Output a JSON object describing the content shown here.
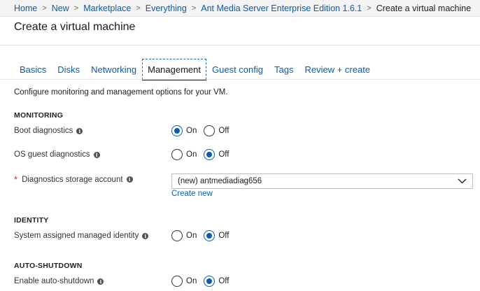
{
  "breadcrumb": {
    "items": [
      "Home",
      "New",
      "Marketplace",
      "Everything",
      "Ant Media Server Enterprise Edition 1.6.1"
    ],
    "current": "Create a virtual machine"
  },
  "page": {
    "title": "Create a virtual machine"
  },
  "tabs": {
    "items": [
      "Basics",
      "Disks",
      "Networking",
      "Management",
      "Guest config",
      "Tags",
      "Review + create"
    ],
    "active": "Management"
  },
  "description": "Configure monitoring and management options for your VM.",
  "monitoring": {
    "heading": "MONITORING",
    "boot_diagnostics": {
      "label": "Boot diagnostics",
      "on": "On",
      "off": "Off",
      "selected": "On"
    },
    "os_guest_diagnostics": {
      "label": "OS guest diagnostics",
      "on": "On",
      "off": "Off",
      "selected": "Off"
    },
    "storage_account": {
      "required_mark": "*",
      "label": "Diagnostics storage account",
      "value": "(new) antmediadiag656",
      "create_new": "Create new"
    }
  },
  "identity": {
    "heading": "IDENTITY",
    "managed_identity": {
      "label": "System assigned managed identity",
      "on": "On",
      "off": "Off",
      "selected": "Off"
    }
  },
  "auto_shutdown": {
    "heading": "AUTO-SHUTDOWN",
    "enable": {
      "label": "Enable auto-shutdown",
      "on": "On",
      "off": "Off",
      "selected": "Off"
    }
  },
  "colors": {
    "link": "#0b5cad",
    "accent": "#0b5cad",
    "required": "#c42b1c"
  },
  "icons": {
    "info": "info-icon",
    "dropdown": "chevron-down-icon"
  }
}
